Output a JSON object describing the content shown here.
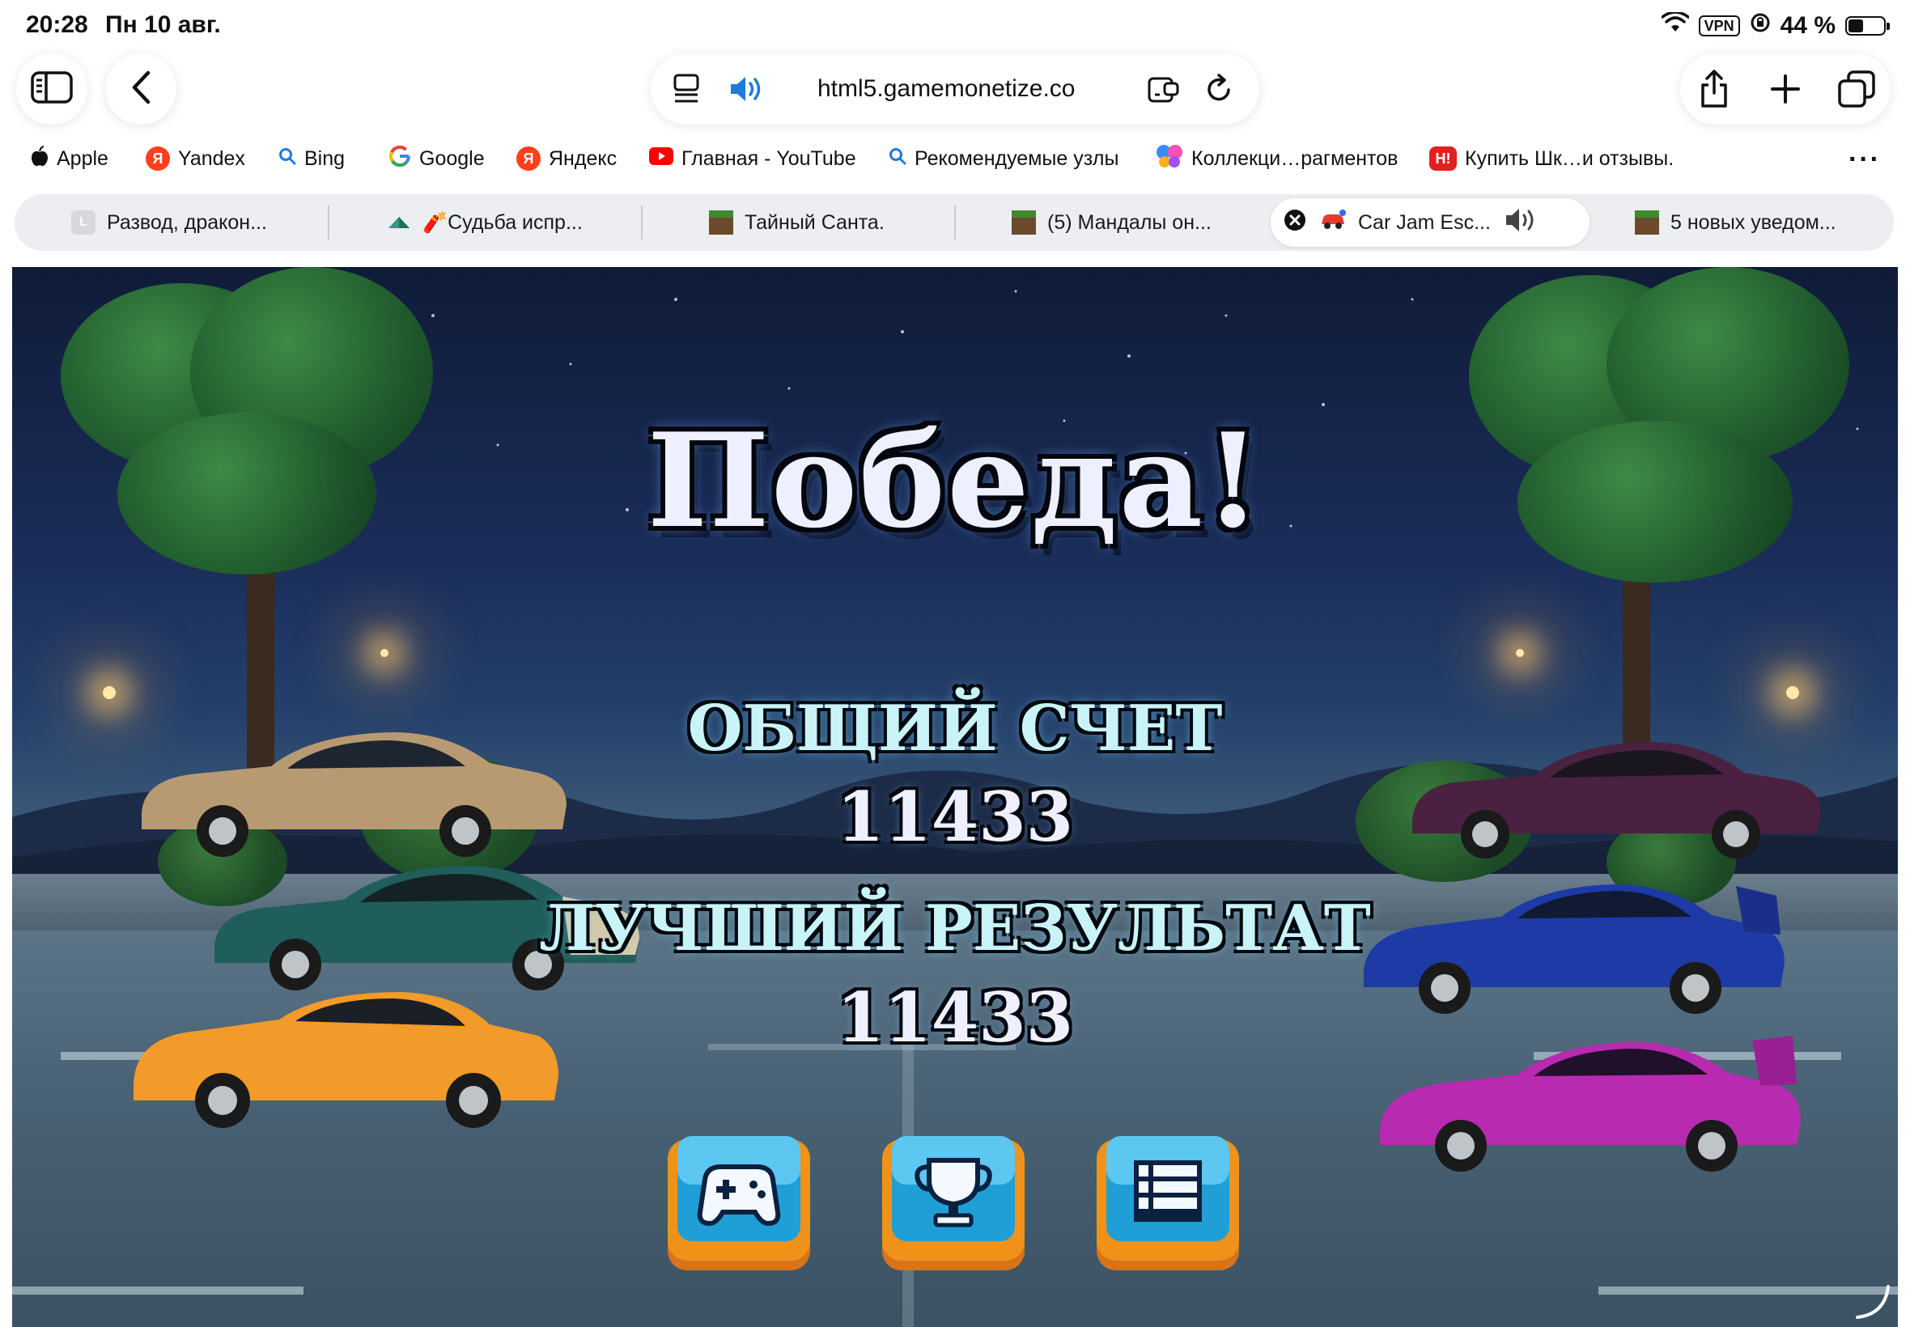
{
  "status_bar": {
    "time": "20:28",
    "date": "Пн 10 авг.",
    "vpn": "VPN",
    "battery": "44 %",
    "battery_level": 0.44
  },
  "toolbar": {
    "url": "html5.gamemonetize.co",
    "icons": [
      "sidebar-icon",
      "back-icon",
      "reader-icon",
      "speaker-icon",
      "extension-icon",
      "reload-icon",
      "share-icon",
      "plus-icon",
      "tabs-icon"
    ]
  },
  "bookmarks": [
    {
      "label": "Apple",
      "icon": "apple-icon"
    },
    {
      "label": "Yandex",
      "icon": "yandex-icon"
    },
    {
      "label": "Bing",
      "icon": "search-icon"
    },
    {
      "label": "Google",
      "icon": "google-icon"
    },
    {
      "label": "Яндекс",
      "icon": "yandex-icon"
    },
    {
      "label": "Главная - YouTube",
      "icon": "youtube-icon"
    },
    {
      "label": "Рекомендуемые узлы",
      "icon": "search-icon"
    },
    {
      "label": "Коллекци…рагментов",
      "icon": "butterfly-icon"
    },
    {
      "label": "Купить Шк…и отзывы.",
      "icon": "store-icon"
    }
  ],
  "tabs": [
    {
      "label": "Развод, дракон...",
      "badge": "L",
      "active": false
    },
    {
      "label": "🧨Судьба испр...",
      "active": false
    },
    {
      "label": "Тайный Санта.",
      "active": false
    },
    {
      "label": "(5) Мандалы он...",
      "active": false
    },
    {
      "label": "Car Jam Esc...",
      "active": true
    },
    {
      "label": "5 новых уведом...",
      "active": false
    }
  ],
  "game": {
    "title": "Победа!",
    "total_score_label": "ОБЩИЙ СЧЕТ",
    "total_score": "11433",
    "best_result_label": "ЛУЧШИЙ РЕЗУЛЬТАТ",
    "best_result": "11433",
    "buttons": [
      "gamepad-icon",
      "trophy-icon",
      "menu-list-icon"
    ],
    "colors": {
      "button_face": "#1f9fd6",
      "button_frame": "#f0921a",
      "title_fill": "#eef0ff",
      "label_fill": "#c9f4f7"
    }
  }
}
